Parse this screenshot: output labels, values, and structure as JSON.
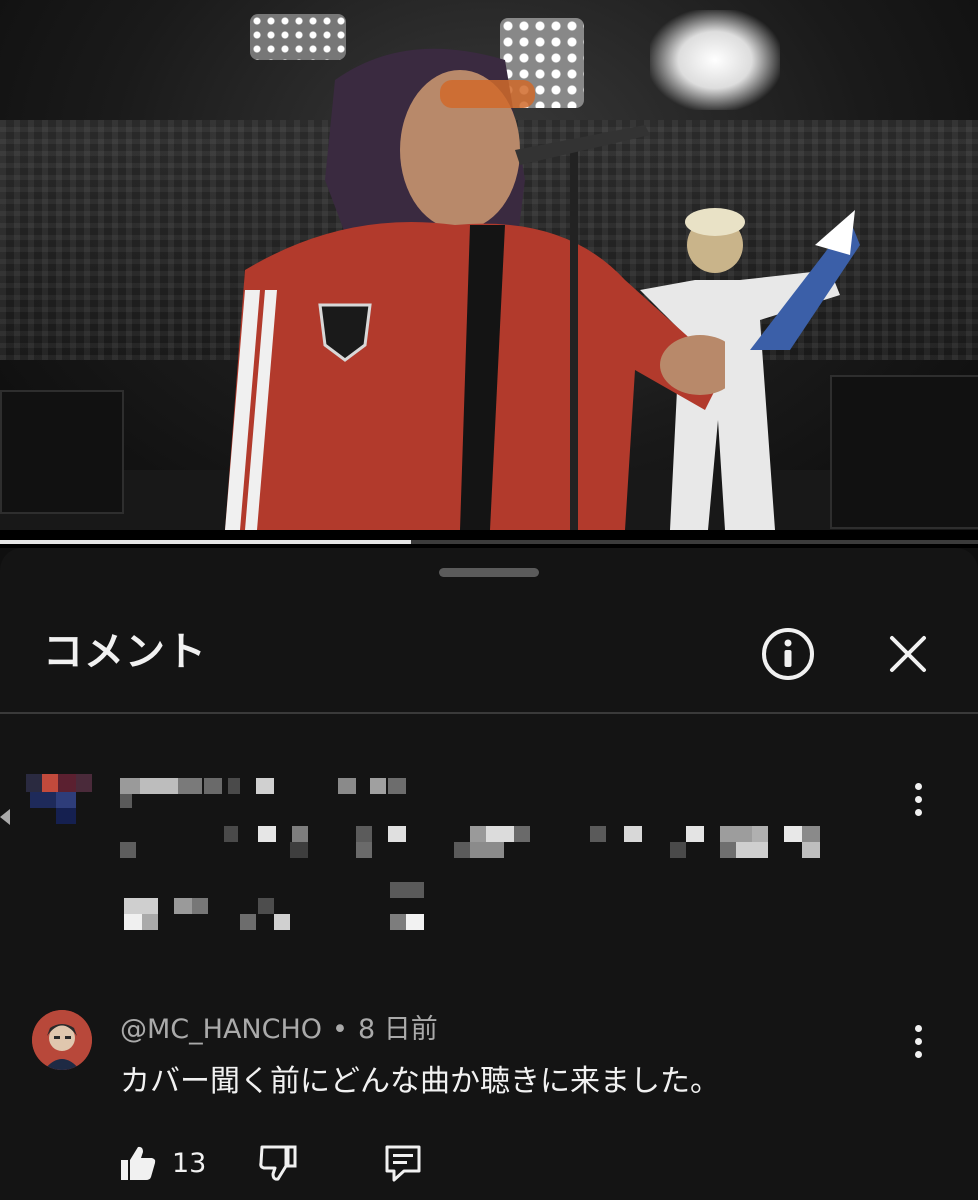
{
  "video": {
    "progress": 0.42
  },
  "comments_panel": {
    "title": "コメント",
    "info_icon": "info-icon",
    "close_icon": "close-icon"
  },
  "comments": [
    {
      "redacted": true,
      "menu_icon": "more-vert-icon"
    },
    {
      "author": "@MC_HANCHO",
      "separator": "•",
      "time": "8 日前",
      "text": "カバー聞く前にどんな曲か聴きに来ました。",
      "likes": "13",
      "like_icon": "thumbs-up-icon",
      "dislike_icon": "thumbs-down-icon",
      "reply_icon": "reply-icon",
      "menu_icon": "more-vert-icon"
    }
  ],
  "colors": {
    "background": "#0f0f0f",
    "sheet": "#141414",
    "text_primary": "#f1f1f1",
    "text_secondary": "#aaaaaa",
    "singer_jacket": "#b23a2c"
  }
}
